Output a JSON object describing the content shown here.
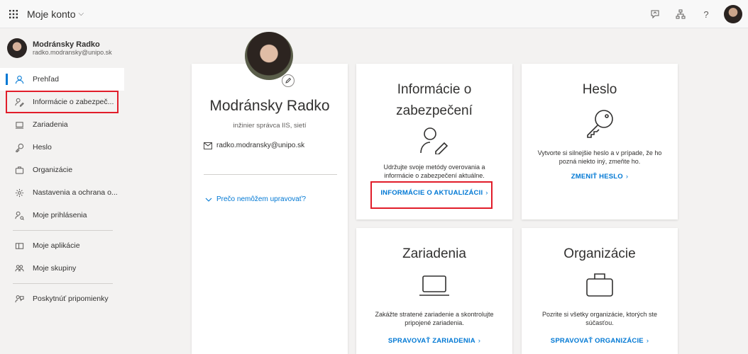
{
  "topbar": {
    "app_title": "Moje konto",
    "chevron": "⌵",
    "icons": [
      "waffle-icon",
      "feedback-icon",
      "org-chart-icon",
      "help-icon",
      "avatar"
    ],
    "help_glyph": "?"
  },
  "sidebar": {
    "user_name": "Modránsky Radko",
    "user_email": "radko.modransky@unipo.sk",
    "items": [
      {
        "label": "Prehľad",
        "icon": "person-icon"
      },
      {
        "label": "Informácie o zabezpeč...",
        "icon": "security-info-icon"
      },
      {
        "label": "Zariadenia",
        "icon": "laptop-icon"
      },
      {
        "label": "Heslo",
        "icon": "key-icon"
      },
      {
        "label": "Organizácie",
        "icon": "briefcase-icon"
      },
      {
        "label": "Nastavenia a ochrana o...",
        "icon": "gear-icon"
      },
      {
        "label": "Moje prihlásenia",
        "icon": "sign-ins-icon"
      },
      {
        "label": "Moje aplikácie",
        "icon": "apps-icon"
      },
      {
        "label": "Moje skupiny",
        "icon": "groups-icon"
      },
      {
        "label": "Poskytnúť pripomienky",
        "icon": "feedback-icon"
      }
    ]
  },
  "profile": {
    "name": "Modránsky Radko",
    "title": "inžinier správca IIS, sietí",
    "email": "radko.modransky@unipo.sk",
    "why_link": "Prečo nemôžem upravovať?"
  },
  "cards": {
    "security": {
      "title_line1": "Informácie o",
      "title_line2": "zabezpečení",
      "desc_line1": "Udržujte svoje metódy overovania a",
      "desc_line2": "informácie o zabezpečení aktuálne.",
      "link": "INFORMÁCIE O AKTUALIZÁCII",
      "arrow": "›"
    },
    "password": {
      "title": "Heslo",
      "desc_line1": "Vytvorte si silnejšie heslo a v prípade, že ho",
      "desc_line2": "pozná niekto iný, zmeňte ho.",
      "link": "ZMENIŤ HESLO",
      "arrow": "›"
    },
    "devices": {
      "title": "Zariadenia",
      "desc_line1": "Zakážte stratené zariadenie a skontrolujte",
      "desc_line2": "pripojené zariadenia.",
      "link": "SPRAVOVAŤ ZARIADENIA",
      "arrow": "›"
    },
    "organizations": {
      "title": "Organizácie",
      "desc_line1": "Pozrite si všetky organizácie, ktorých ste",
      "desc_line2": "súčasťou.",
      "link": "SPRAVOVAŤ ORGANIZÁCIE",
      "arrow": "›"
    }
  },
  "colors": {
    "accent": "#0078d4",
    "highlight": "#e11d2a",
    "background": "#f3f2f1"
  }
}
